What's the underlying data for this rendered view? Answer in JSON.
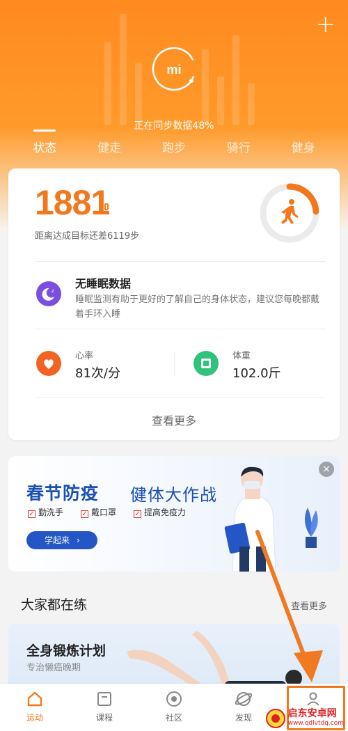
{
  "header": {
    "sync_status": "正在同步数据48%",
    "logo_text": "mi",
    "tabs": [
      {
        "label": "状态",
        "active": true
      },
      {
        "label": "健走",
        "active": false
      },
      {
        "label": "跑步",
        "active": false
      },
      {
        "label": "骑行",
        "active": false
      },
      {
        "label": "健身",
        "active": false
      }
    ],
    "add_label": "+",
    "colors": {
      "accent": "#f3781d",
      "header_top": "#ff8a1f"
    }
  },
  "activity": {
    "steps": "1881",
    "goal_remaining_text": "距离达成目标还差6119步",
    "progress_fraction": 0.24,
    "icon": "walking-person-icon"
  },
  "sleep": {
    "title": "无睡眠数据",
    "description": "睡眠监测有助于更好的了解自己的身体状态，建议您每晚都戴着手环入睡",
    "icon": "moon-sleep-icon"
  },
  "heart_rate": {
    "label": "心率",
    "value": "81次/分",
    "icon": "heart-icon"
  },
  "weight": {
    "label": "体重",
    "value": "102.0斤",
    "icon": "scale-icon"
  },
  "card_more": "查看更多",
  "banner": {
    "title_bold": "春节防疫",
    "title_rest": "健体大作战",
    "checks": [
      "勤洗手",
      "戴口罩",
      "提高免疫力"
    ],
    "button_label": "学起来",
    "close_label": "×"
  },
  "section": {
    "title": "大家都在练",
    "more": "查看更多",
    "plan_title": "全身锻炼计划",
    "plan_subtitle": "专治懒癌晚期"
  },
  "nav": {
    "items": [
      {
        "label": "运动",
        "icon": "home-icon",
        "active": true
      },
      {
        "label": "课程",
        "icon": "course-icon",
        "active": false
      },
      {
        "label": "社区",
        "icon": "community-icon",
        "active": false
      },
      {
        "label": "发现",
        "icon": "discover-icon",
        "active": false
      },
      {
        "label": "",
        "icon": "profile-icon",
        "active": false
      }
    ]
  },
  "watermark": {
    "name": "启东安卓网",
    "url": "www.qdlvtdq.com"
  }
}
